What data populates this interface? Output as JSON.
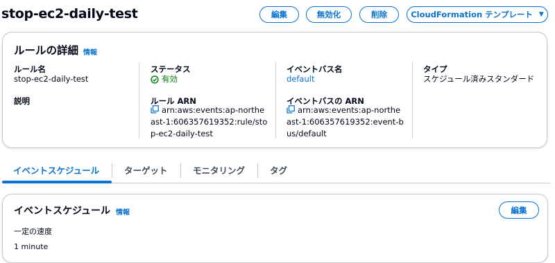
{
  "header": {
    "title": "stop-ec2-daily-test",
    "buttons": {
      "edit": "編集",
      "disable": "無効化",
      "delete": "削除",
      "cloudformation": "CloudFormation テンプレート"
    }
  },
  "details": {
    "title": "ルールの詳細",
    "info": "情報",
    "rule_name_label": "ルール名",
    "rule_name": "stop-ec2-daily-test",
    "description_label": "説明",
    "status_label": "ステータス",
    "status": "有効",
    "rule_arn_label": "ルール ARN",
    "rule_arn": "arn:aws:events:ap-northeast-1:606357619352:rule/stop-ec2-daily-test",
    "event_bus_name_label": "イベントバス名",
    "event_bus_name": "default",
    "event_bus_arn_label": "イベントバスの ARN",
    "event_bus_arn": "arn:aws:events:ap-northeast-1:606357619352:event-bus/default",
    "type_label": "タイプ",
    "type": "スケジュール済みスタンダード"
  },
  "tabs": [
    {
      "label": "イベントスケジュール",
      "active": true
    },
    {
      "label": "ターゲット",
      "active": false
    },
    {
      "label": "モニタリング",
      "active": false
    },
    {
      "label": "タグ",
      "active": false
    }
  ],
  "schedule": {
    "title": "イベントスケジュール",
    "info": "情報",
    "edit": "編集",
    "rate_label": "一定の速度",
    "rate_value": "1 minute"
  },
  "colors": {
    "accent": "#0972d3",
    "success": "#037f0c",
    "text": "#000716"
  }
}
